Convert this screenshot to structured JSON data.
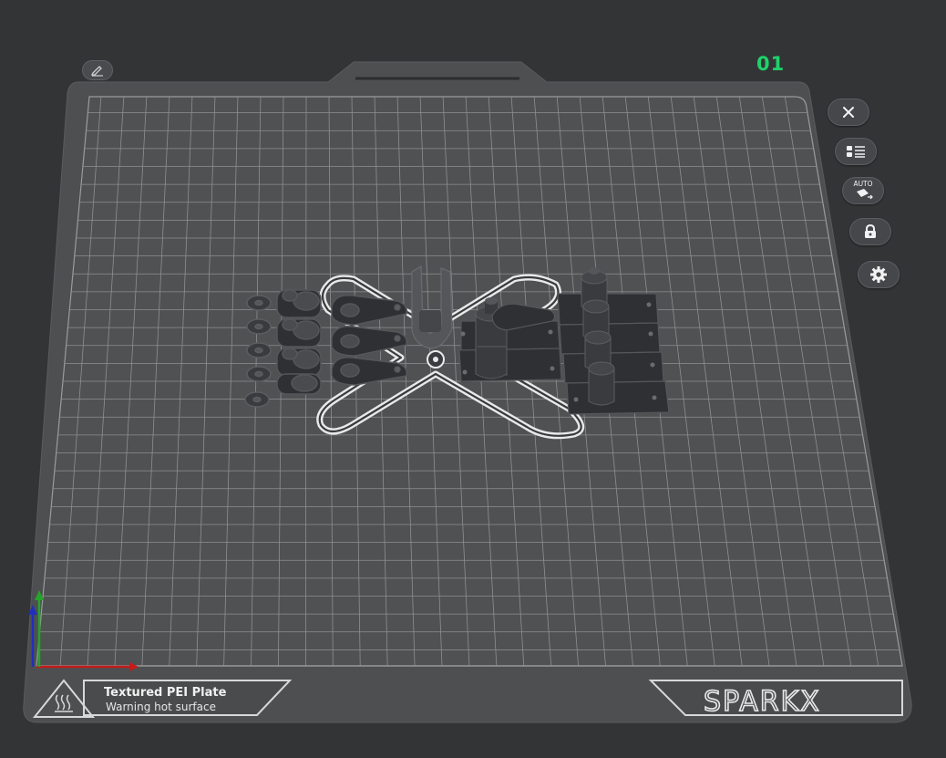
{
  "plate": {
    "number": "01",
    "label_title": "Textured PEI Plate",
    "label_warning": "Warning hot surface",
    "brand": "SPARKX"
  },
  "colors": {
    "background": "#333436",
    "plate_body": "#4e4f51",
    "grid_line": "#8e8f91",
    "plate_number": "#1fd16a",
    "axis_x": "#c41b1b",
    "axis_y": "#23a52a",
    "axis_z": "#2030b8",
    "model": "#3d3e41"
  },
  "toolbar": {
    "items": [
      {
        "name": "close",
        "icon": "close-icon"
      },
      {
        "name": "object-list",
        "icon": "list-icon"
      },
      {
        "name": "auto-orient",
        "icon": "auto-orient-icon",
        "badge": "AUTO"
      },
      {
        "name": "lock",
        "icon": "lock-icon"
      },
      {
        "name": "settings",
        "icon": "gear-icon"
      }
    ]
  }
}
